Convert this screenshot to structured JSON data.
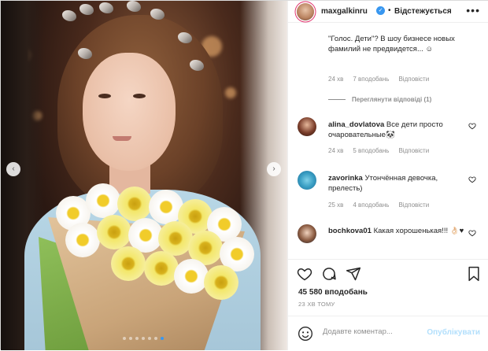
{
  "header": {
    "username": "maxgalkinru",
    "follow_status": "Відстежується",
    "separator": "•"
  },
  "comments": [
    {
      "text": "\"Голос. Дети\"? В шоу бизнесе новых фамилий не предвидется... ☺",
      "time": "24 хв",
      "likes": "7 вподобань",
      "reply": "Відповісти",
      "view_replies": "Переглянути відповіді (1)"
    },
    {
      "username": "alina_dovlatova",
      "text": "Все дети просто очаровательные🐼",
      "time": "24 хв",
      "likes": "5 вподобань",
      "reply": "Відповісти"
    },
    {
      "username": "zavorinka",
      "text": "Утончённая девочка, прелесть)",
      "time": "25 хв",
      "likes": "4 вподобань",
      "reply": "Відповісти"
    },
    {
      "username": "bochkova01",
      "text": "Какая хорошенькая!!! 👌🏻♥"
    }
  ],
  "footer": {
    "likes": "45 580 вподобань",
    "time": "23 ХВ ТОМУ",
    "comment_placeholder": "Додавте коментар...",
    "publish_label": "Опублікувати"
  },
  "carousel": {
    "slide_count": 7,
    "active_index": 6
  },
  "colors": {
    "link_blue": "#3897f0",
    "publish_disabled": "#b2dffc",
    "secondary_text": "#8e8e8e"
  },
  "icons": [
    "heart-icon",
    "comment-icon",
    "share-icon",
    "bookmark-icon",
    "emoji-icon",
    "more-options-icon",
    "verified-badge-icon",
    "chevron-left-icon",
    "chevron-right-icon"
  ]
}
